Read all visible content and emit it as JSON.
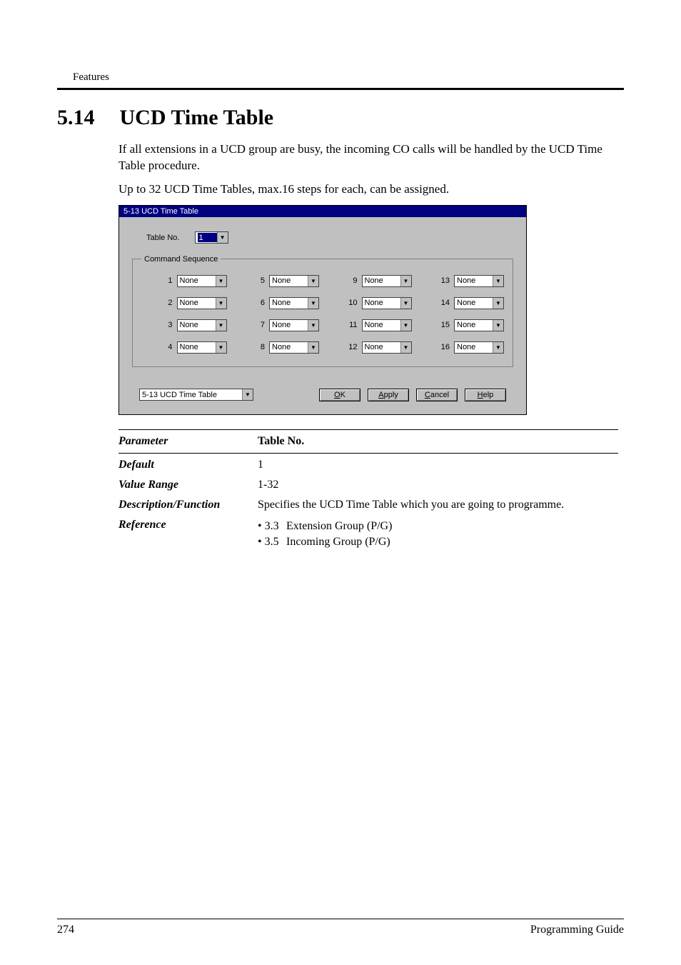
{
  "header": {
    "label": "Features"
  },
  "section": {
    "number": "5.14",
    "title": "UCD Time Table"
  },
  "intro": {
    "p1": "If all extensions in a UCD group are busy, the incoming CO calls will be handled by the UCD Time Table procedure.",
    "p2": "Up to 32 UCD Time Tables, max.16 steps for each, can be assigned."
  },
  "dialog": {
    "title": "5-13 UCD Time Table",
    "tableNoLabel": "Table No.",
    "tableNoValue": "1",
    "legend": "Command Sequence",
    "steps": [
      {
        "n": "1",
        "v": "None"
      },
      {
        "n": "5",
        "v": "None"
      },
      {
        "n": "9",
        "v": "None"
      },
      {
        "n": "13",
        "v": "None"
      },
      {
        "n": "2",
        "v": "None"
      },
      {
        "n": "6",
        "v": "None"
      },
      {
        "n": "10",
        "v": "None"
      },
      {
        "n": "14",
        "v": "None"
      },
      {
        "n": "3",
        "v": "None"
      },
      {
        "n": "7",
        "v": "None"
      },
      {
        "n": "11",
        "v": "None"
      },
      {
        "n": "15",
        "v": "None"
      },
      {
        "n": "4",
        "v": "None"
      },
      {
        "n": "8",
        "v": "None"
      },
      {
        "n": "12",
        "v": "None"
      },
      {
        "n": "16",
        "v": "None"
      }
    ],
    "screenSelector": "5-13 UCD Time Table",
    "buttons": {
      "ok": "OK",
      "apply": "Apply",
      "cancel": "Cancel",
      "help": "Help"
    },
    "ul": {
      "ok": "O",
      "apply": "A",
      "cancel": "C",
      "help": "H"
    }
  },
  "params": {
    "header": {
      "k": "Parameter",
      "v": "Table No."
    },
    "default": {
      "k": "Default",
      "v": "1"
    },
    "range": {
      "k": "Value Range",
      "v": "1-32"
    },
    "desc": {
      "k": "Description/Function",
      "v": "Specifies the UCD Time Table which you are going to programme."
    },
    "ref": {
      "k": "Reference",
      "items": [
        {
          "b": "• 3.3",
          "t": "Extension Group (P/G)"
        },
        {
          "b": "• 3.5",
          "t": "Incoming Group (P/G)"
        }
      ]
    }
  },
  "footer": {
    "pageNum": "274",
    "bookTitle": "Programming Guide"
  }
}
